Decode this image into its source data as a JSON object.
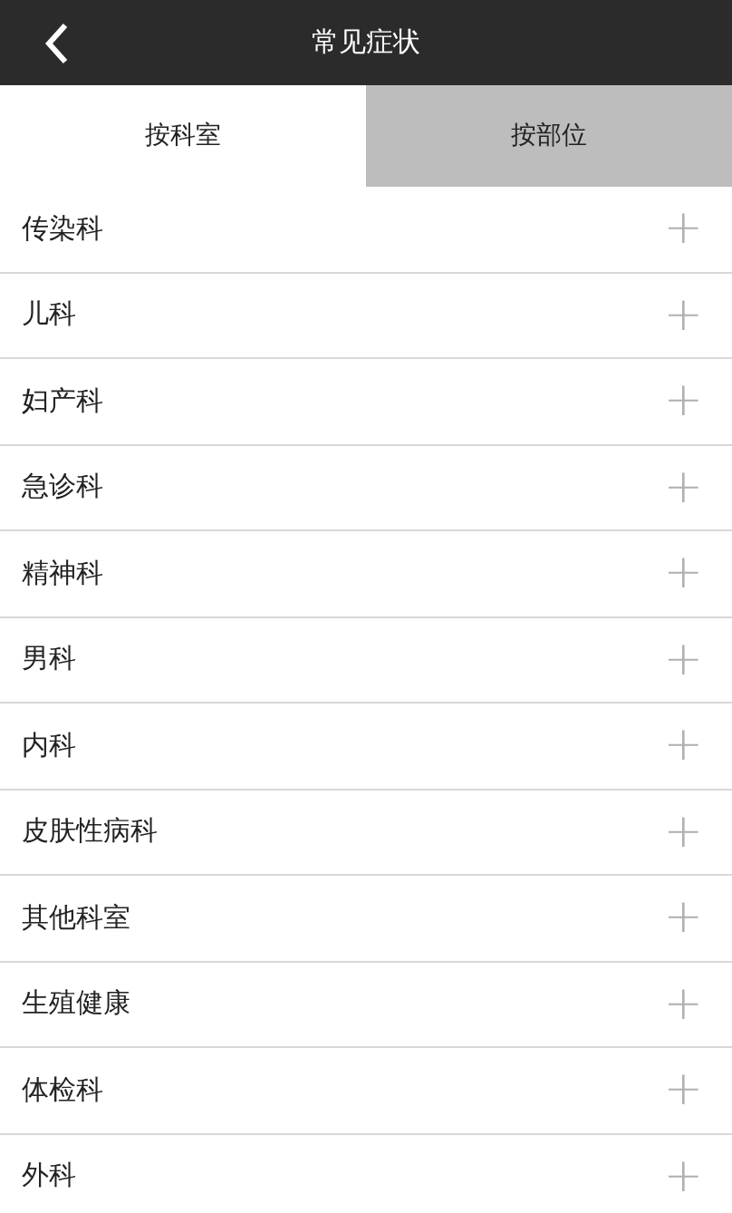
{
  "header": {
    "title": "常见症状"
  },
  "tabs": [
    {
      "label": "按科室",
      "selected": true
    },
    {
      "label": "按部位",
      "selected": false
    }
  ],
  "departments": [
    {
      "name": "传染科",
      "expand": "+"
    },
    {
      "name": "儿科",
      "expand": "+"
    },
    {
      "name": "妇产科",
      "expand": "+"
    },
    {
      "name": "急诊科",
      "expand": "+"
    },
    {
      "name": "精神科",
      "expand": "+"
    },
    {
      "name": "男科",
      "expand": "+"
    },
    {
      "name": "内科",
      "expand": "+"
    },
    {
      "name": "皮肤性病科",
      "expand": "+"
    },
    {
      "name": "其他科室",
      "expand": "+"
    },
    {
      "name": "生殖健康",
      "expand": "+"
    },
    {
      "name": "体检科",
      "expand": "+"
    },
    {
      "name": "外科",
      "expand": "+"
    }
  ]
}
